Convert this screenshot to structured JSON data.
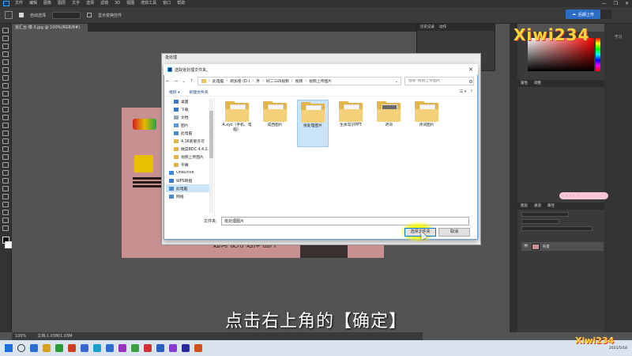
{
  "photoshop": {
    "menu_items": [
      "文件",
      "编辑",
      "图像",
      "图层",
      "文字",
      "选择",
      "滤镜",
      "3D",
      "视图",
      "增效工具",
      "窗口",
      "帮助"
    ],
    "window_controls": [
      "—",
      "❐",
      "✕"
    ],
    "options": {
      "auto_select_label": "自动选择",
      "transform_label": "显示变换控件"
    },
    "cloud_button": "后期上传",
    "document_tab": "批汇台 博-3.jpg @ 100%(RGB/8#)",
    "history_panel": {
      "tabs": [
        "历史记录",
        "动作"
      ],
      "items": [
        "",
        "",
        "",
        "",
        "",
        ""
      ]
    },
    "properties_tabs": [
      "属性",
      "调整"
    ],
    "properties_lines": [
      "",
      "",
      "",
      "",
      ""
    ],
    "layers_tabs": [
      "图层",
      "通道",
      "路径"
    ],
    "layer_name": "背景",
    "right_icon_labels": [
      "学习"
    ],
    "status_left": "100%",
    "status_doc": "文档:1.03M/1.03M"
  },
  "canvas": {
    "caption": "起词 使用 选择 图片"
  },
  "batch_dialog": {
    "title": "批处理"
  },
  "folder_picker": {
    "title": "选取批处理文件夹。",
    "close_glyph": "✕",
    "nav": {
      "back": "←",
      "forward": "→",
      "up_dropdown": "⌄",
      "up": "↑"
    },
    "breadcrumbs": [
      "此电脑",
      "新加卷 (D:)",
      "月",
      "好二三四视频",
      "视频",
      "视频上传图片"
    ],
    "crumb_separator": "›",
    "search_placeholder": "搜索\"视频上传图片\"",
    "commands": {
      "organize": "组织 ▾",
      "new_folder": "新建文件夹"
    },
    "view_glyphs": [
      "☰ ▾",
      "?"
    ],
    "sidebar": [
      {
        "label": "桌面",
        "icon": "desktop-icon",
        "color": "#3a78c8",
        "pinned": true,
        "indent": true
      },
      {
        "label": "下载",
        "icon": "download-icon",
        "color": "#3a78c8",
        "pinned": true,
        "indent": true
      },
      {
        "label": "文档",
        "icon": "documents-icon",
        "color": "#9aa6b8",
        "pinned": true,
        "indent": true
      },
      {
        "label": "图片",
        "icon": "pictures-icon",
        "color": "#5a9ad8",
        "pinned": true,
        "indent": true
      },
      {
        "label": "此电脑",
        "icon": "this-pc-icon",
        "color": "#4a8ad0",
        "pinned": true,
        "indent": true
      },
      {
        "label": "4.16底版许可",
        "icon": "folder-icon",
        "color": "#e3b34c",
        "pinned": false,
        "indent": true
      },
      {
        "label": "微菜BDC.4.4.2.1",
        "icon": "folder-icon",
        "color": "#e3b34c",
        "pinned": false,
        "indent": true
      },
      {
        "label": "视频上传图片",
        "icon": "folder-icon",
        "color": "#e3b34c",
        "pinned": false,
        "indent": true
      },
      {
        "label": "字幕",
        "icon": "folder-icon",
        "color": "#e3b34c",
        "pinned": false,
        "indent": true
      },
      {
        "label": "OneDrive",
        "icon": "onedrive-icon",
        "color": "#3a8ae0",
        "pinned": false,
        "indent": false
      },
      {
        "label": "WPS网盘",
        "icon": "wps-cloud-icon",
        "color": "#3a7ad0",
        "pinned": false,
        "indent": false
      },
      {
        "label": "此电脑",
        "icon": "this-pc-icon",
        "color": "#4a8ad0",
        "pinned": false,
        "indent": false,
        "selected": true
      },
      {
        "label": "网络",
        "icon": "network-icon",
        "color": "#4a8ad0",
        "pinned": false,
        "indent": false
      }
    ],
    "pin_glyph": "✲",
    "folders": [
      {
        "label": "A.xyc（手机、电脑）",
        "paper": "light"
      },
      {
        "label": "成西图片",
        "paper": "light"
      },
      {
        "label": "批处理图片",
        "paper": "light",
        "selected": true
      },
      {
        "label": "生体常识PPT",
        "paper": "light"
      },
      {
        "label": "诗词",
        "paper": "dark"
      },
      {
        "label": "诗词图片",
        "paper": "light"
      }
    ],
    "folder_field_label": "文件夹:",
    "folder_field_value": "批处理图片",
    "select_button": "选择文件夹",
    "cancel_button": "取消"
  },
  "subtitle": "点击右上角的【确定】",
  "watermark": "Xiwi234",
  "taskbar": {
    "apps": [
      "#2a6fd0",
      "#d8a020",
      "#2a9a3a",
      "#d04020",
      "#3a6ad0",
      "#1aa0d0",
      "#2a6fd0",
      "#9a30c0",
      "#3aa040",
      "#d03030",
      "#2a60c0",
      "#8a3ad0",
      "#2a2a9a",
      "#d05020"
    ],
    "tray_time": "",
    "tray_date": "2021/5/18"
  },
  "colors": {
    "ps_dark": "#323232",
    "ps_panel": "#3a3a3a",
    "accent_blue": "#0078d7",
    "folder_yellow": "#e3b34c",
    "highlight_yellow": "#ffff00"
  }
}
